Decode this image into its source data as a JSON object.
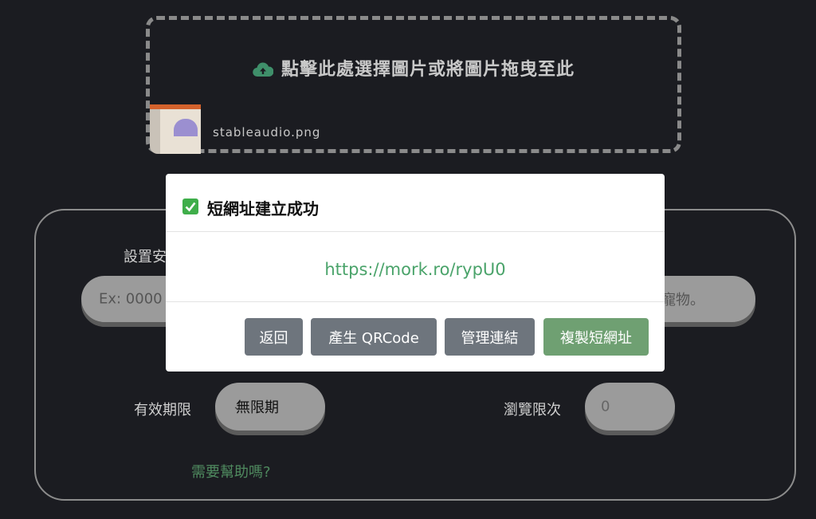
{
  "upload": {
    "prompt": "點擊此處選擇圖片或將圖片拖曳至此",
    "filename": "stableaudio.png"
  },
  "form": {
    "password_label": "設置安",
    "password_placeholder": "Ex: 0000",
    "description_tail": "寵物。",
    "expiry_label": "有效期限",
    "expiry_value": "無限期",
    "view_limit_label": "瀏覽限次",
    "view_limit_value": "0",
    "help_link": "需要幫助嗎?"
  },
  "modal": {
    "title_icon": "✅",
    "title": "短網址建立成功",
    "short_url": "https://mork.ro/rypU0",
    "buttons": {
      "back": "返回",
      "qrcode": "產生 QRCode",
      "manage": "管理連結",
      "copy": "複製短網址"
    }
  },
  "colors": {
    "background": "#1b1c21",
    "accent_green": "#4aa36a",
    "copy_button": "#6fa072",
    "gray_button": "#6e757d"
  }
}
